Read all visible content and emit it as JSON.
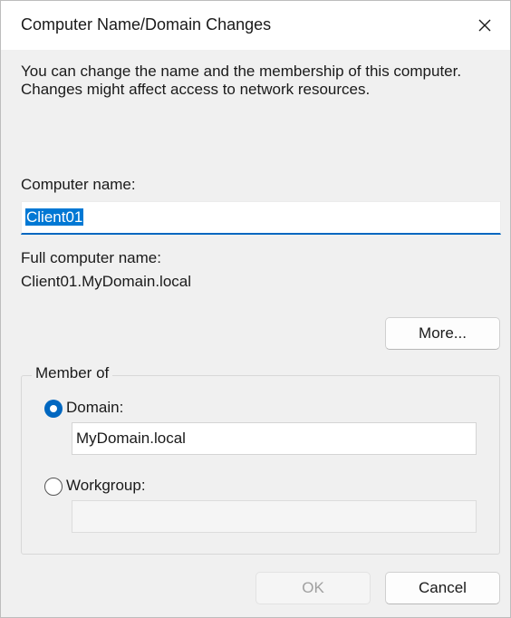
{
  "window": {
    "title": "Computer Name/Domain Changes"
  },
  "description": "You can change the name and the membership of this computer. Changes might affect access to network resources.",
  "computer_name": {
    "label": "Computer name:",
    "value": "Client01"
  },
  "full_name": {
    "label": "Full computer name:",
    "value": "Client01.MyDomain.local"
  },
  "buttons": {
    "more": "More...",
    "ok": "OK",
    "cancel": "Cancel"
  },
  "member_of": {
    "legend": "Member of",
    "domain": {
      "label": "Domain:",
      "value": "MyDomain.local",
      "selected": true
    },
    "workgroup": {
      "label": "Workgroup:",
      "value": "",
      "selected": false
    }
  },
  "colors": {
    "accent": "#0067c0",
    "selection": "#0078d4"
  }
}
